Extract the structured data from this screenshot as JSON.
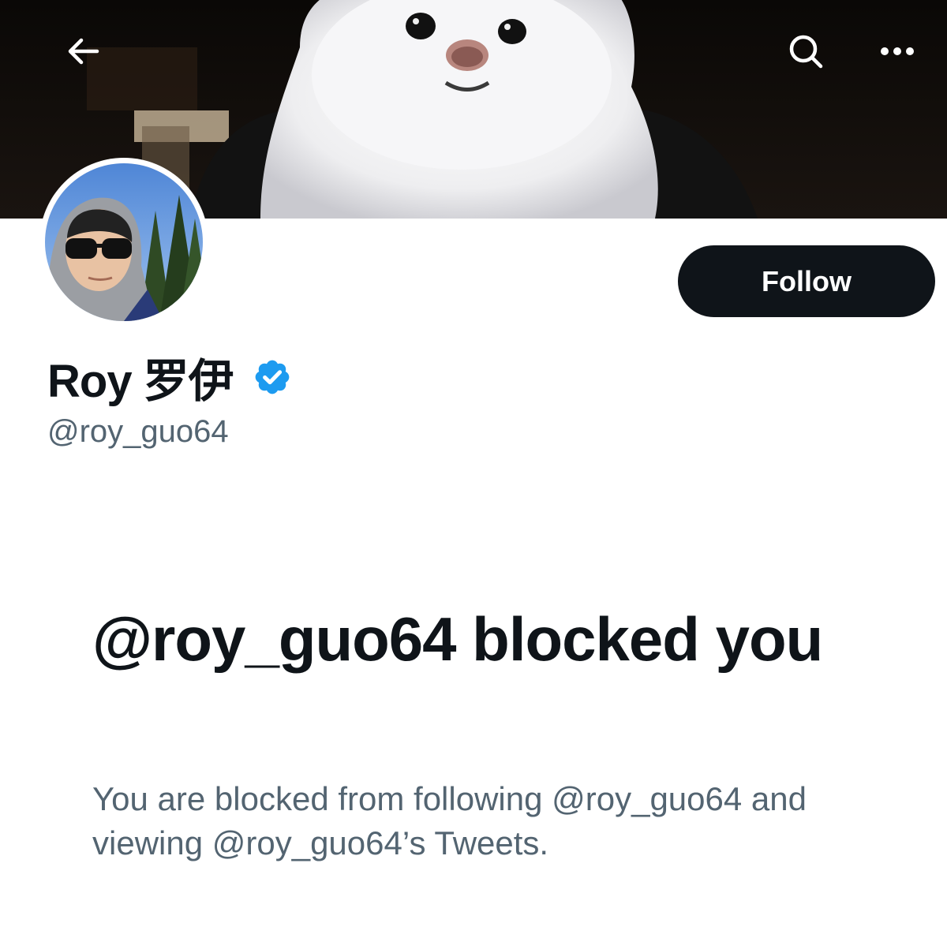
{
  "header": {
    "back_icon": "back-arrow-icon",
    "search_icon": "search-icon",
    "more_icon": "more-horizontal-icon"
  },
  "banner": {
    "image": "white-fluffy-dog-photo"
  },
  "profile": {
    "avatar": "person-in-hood-with-sunglasses-photo",
    "display_name": "Roy 罗伊",
    "verified_icon": "verified-badge-icon",
    "handle": "@roy_guo64",
    "follow_label": "Follow"
  },
  "blocked": {
    "title": "@roy_guo64 blocked you",
    "description": "You are blocked from following @roy_guo64 and viewing @roy_guo64’s Tweets."
  },
  "colors": {
    "text_primary": "#0f1419",
    "text_secondary": "#536471",
    "verified_blue": "#1d9bf0",
    "follow_bg": "#0f1419"
  }
}
